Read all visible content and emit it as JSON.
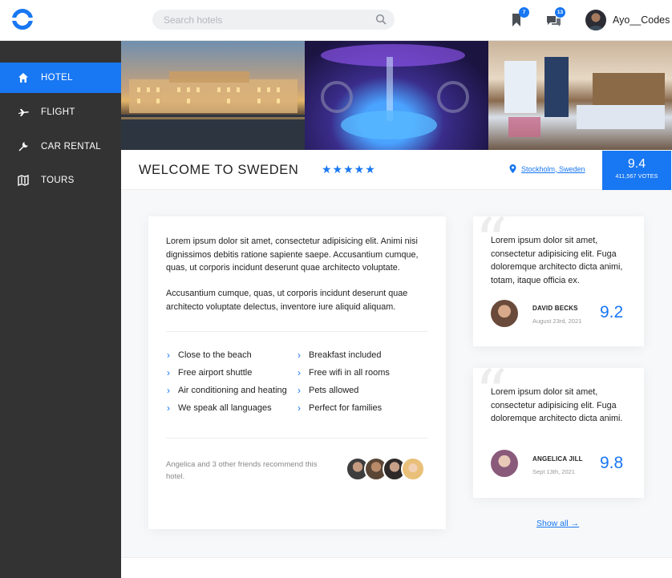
{
  "topbar": {
    "search_placeholder": "Search hotels",
    "bookmarks_badge": "7",
    "messages_badge": "13",
    "username": "Ayo__Codes"
  },
  "sidebar": {
    "items": [
      {
        "label": "HOTEL",
        "icon": "home-icon",
        "active": true
      },
      {
        "label": "FLIGHT",
        "icon": "plane-icon",
        "active": false
      },
      {
        "label": "CAR RENTAL",
        "icon": "wrench-icon",
        "active": false
      },
      {
        "label": "TOURS",
        "icon": "map-icon",
        "active": false
      }
    ]
  },
  "hotel": {
    "title": "WELCOME TO SWEDEN",
    "stars": "★★★★★",
    "location": "Stockholm, Sweden",
    "score": "9.4",
    "votes": "411,567 VOTES"
  },
  "description": {
    "p1": "Lorem ipsum dolor sit amet, consectetur adipisicing elit. Animi nisi dignissimos debitis ratione sapiente saepe. Accusantium cumque, quas, ut corporis incidunt deserunt quae architecto voluptate.",
    "p2": "Accusantium cumque, quas, ut corporis incidunt deserunt quae architecto voluptate delectus, inventore iure aliquid aliquam."
  },
  "amenities": {
    "left": [
      "Close to the beach",
      "Free airport shuttle",
      "Air conditioning and heating",
      "We speak all languages"
    ],
    "right": [
      "Breakfast included",
      "Free wifi in all rooms",
      "Pets allowed",
      "Perfect for families"
    ]
  },
  "recommend_text": "Angelica and 3 other friends recommend this hotel.",
  "reviews": [
    {
      "text": "Lorem ipsum dolor sit amet, consectetur adipisicing elit. Fuga doloremque architecto dicta animi, totam, itaque officia ex.",
      "name": "DAVID BECKS",
      "date": "August 23rd, 2021",
      "score": "9.2"
    },
    {
      "text": "Lorem ipsum dolor sit amet, consectetur adipisicing elit. Fuga doloremque architecto dicta animi.",
      "name": "ANGELICA JILL",
      "date": "Sept 13th, 2021",
      "score": "9.8"
    }
  ],
  "show_all": "Show all →",
  "colors": {
    "accent": "#1877f2",
    "sidebar": "#333333"
  }
}
